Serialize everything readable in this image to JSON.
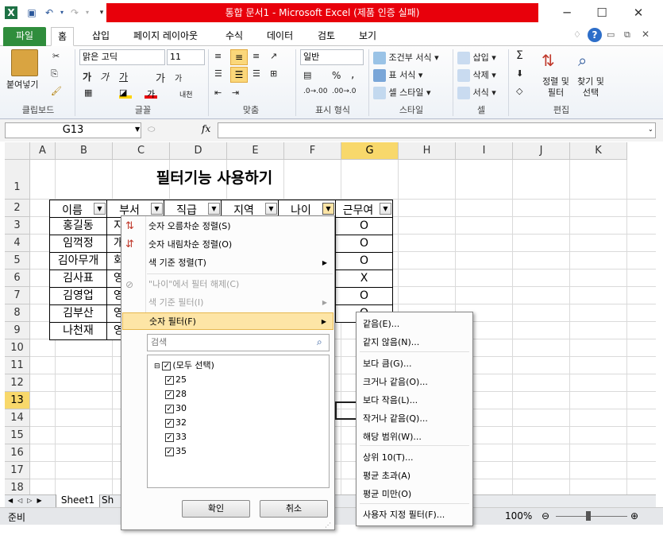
{
  "window": {
    "title": "통합 문서1 - Microsoft Excel (제품 인증 실패)"
  },
  "ribbon_tabs": [
    "파일",
    "홈",
    "삽입",
    "페이지 레이아웃",
    "수식",
    "데이터",
    "검토",
    "보기"
  ],
  "ribbon": {
    "clipboard": {
      "paste": "붙여넣기",
      "label": "클립보드"
    },
    "font": {
      "name": "맑은 고딕",
      "size": "11",
      "bold": "가",
      "italic": "가",
      "underline": "가",
      "grow": "가",
      "shrink": "가",
      "label": "글꼴"
    },
    "align": {
      "label": "맞춤"
    },
    "number": {
      "format": "일반",
      "percent": "%",
      "comma": ",",
      "label": "표시 형식"
    },
    "styles": {
      "cond": "조건부 서식",
      "table": "표 서식",
      "cell": "셀 스타일",
      "label": "스타일"
    },
    "cells": {
      "insert": "삽입",
      "delete": "삭제",
      "format": "서식",
      "label": "셀"
    },
    "edit": {
      "sum": "Σ",
      "sort": "정렬 및 필터",
      "find": "찾기 및 선택",
      "label": "편집"
    }
  },
  "formula_bar": {
    "name_box": "G13",
    "fx": "fx",
    "value": ""
  },
  "columns": [
    "A",
    "B",
    "C",
    "D",
    "E",
    "F",
    "G",
    "H",
    "I",
    "J",
    "K"
  ],
  "rows": [
    "1",
    "2",
    "3",
    "4",
    "5",
    "6",
    "7",
    "8",
    "9",
    "10",
    "11",
    "12",
    "13",
    "14",
    "15",
    "16",
    "17",
    "18"
  ],
  "sheet": {
    "title": "필터기능 사용하기",
    "headers": [
      "이름",
      "부서",
      "직급",
      "지역",
      "나이",
      "근무여"
    ],
    "names": [
      "홍길동",
      "임꺽정",
      "김아무개",
      "김사표",
      "김영업",
      "김부산",
      "나천재"
    ],
    "col_c_partial": [
      "지",
      "개",
      "회",
      "영",
      "영",
      "영",
      "영"
    ],
    "col_g": [
      "O",
      "O",
      "O",
      "X",
      "O",
      "O",
      ""
    ]
  },
  "filter_menu": {
    "items": [
      {
        "label": "숫자 오름차순 정렬(S)",
        "icon": "sort-asc-icon",
        "state": "enabled"
      },
      {
        "label": "숫자 내림차순 정렬(O)",
        "icon": "sort-desc-icon",
        "state": "enabled"
      },
      {
        "label": "색 기준 정렬(T)",
        "state": "enabled",
        "submenu": true
      },
      {
        "label": "\"나이\"에서 필터 해제(C)",
        "icon": "clear-filter-icon",
        "state": "disabled"
      },
      {
        "label": "색 기준 필터(I)",
        "state": "disabled",
        "submenu": true
      },
      {
        "label": "숫자 필터(F)",
        "state": "highlighted",
        "submenu": true
      }
    ],
    "search_placeholder": "검색",
    "checklist": [
      "(모두 선택)",
      "25",
      "28",
      "30",
      "32",
      "33",
      "35"
    ],
    "ok": "확인",
    "cancel": "취소"
  },
  "number_filter_submenu": [
    "같음(E)...",
    "같지 않음(N)...",
    "보다 큼(G)...",
    "크거나 같음(O)...",
    "보다 작음(L)...",
    "작거나 같음(Q)...",
    "해당 범위(W)...",
    "상위 10(T)...",
    "평균 초과(A)",
    "평균 미만(O)",
    "사용자 지정 필터(F)..."
  ],
  "sheet_tabs": [
    "Sheet1",
    "Sh"
  ],
  "status": {
    "ready": "준비",
    "zoom": "100%"
  },
  "colors": {
    "accent_file": "#2f8d3c",
    "title_red": "#e8000b",
    "selection": "#f8d86b",
    "menu_highlight": "#fde5a6"
  }
}
